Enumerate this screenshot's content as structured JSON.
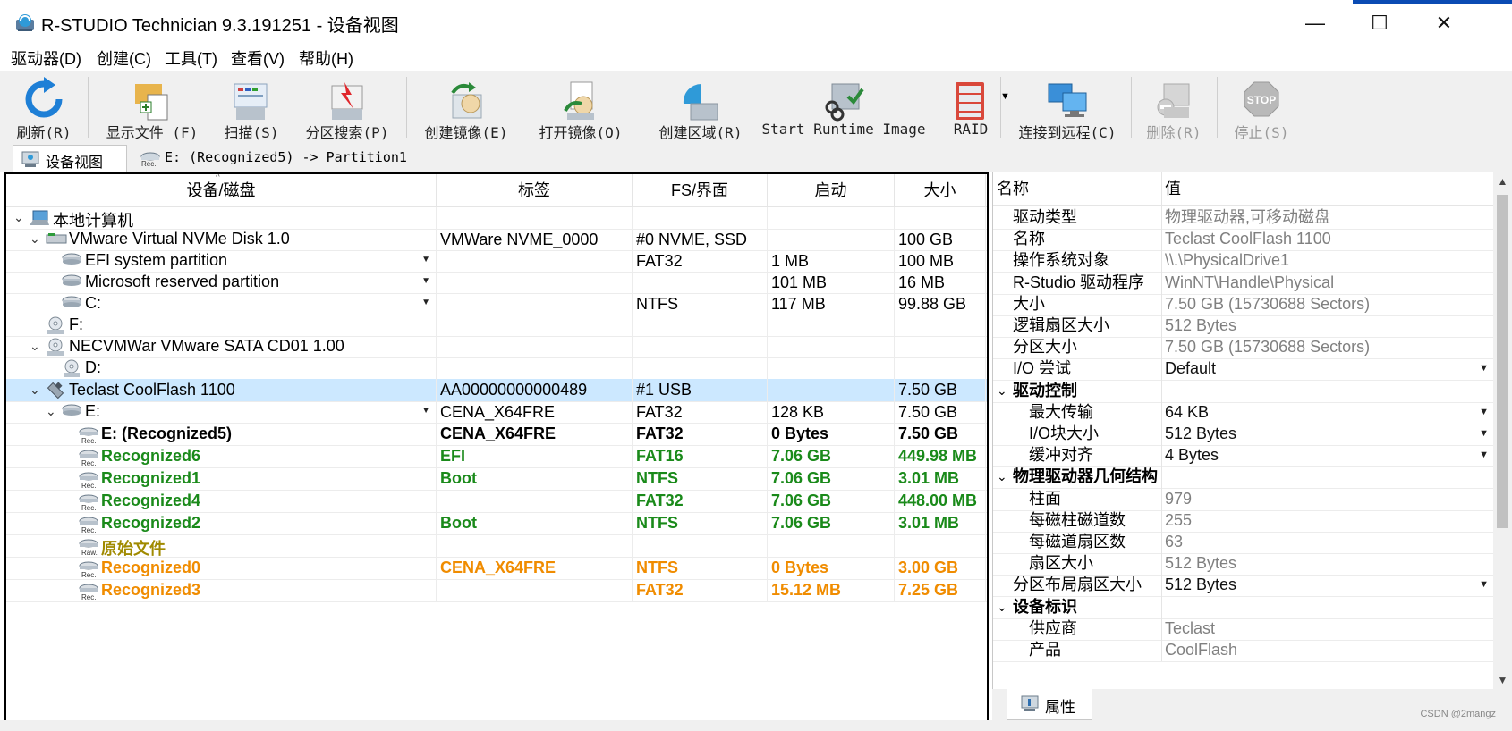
{
  "window": {
    "title": "R-STUDIO Technician 9.3.191251 - 设备视图",
    "minimize": "—",
    "maximize": "☐",
    "close": "✕"
  },
  "menu": [
    "驱动器(D)",
    "创建(C)",
    "工具(T)",
    "查看(V)",
    "帮助(H)"
  ],
  "toolbar": [
    {
      "label": "刷新(R)",
      "icon": "refresh-icon",
      "disabled": false
    },
    {
      "label": "显示文件 (F)",
      "icon": "show-files-icon",
      "disabled": false
    },
    {
      "label": "扫描(S)",
      "icon": "scan-icon",
      "disabled": false
    },
    {
      "label": "分区搜索(P)",
      "icon": "partition-search-icon",
      "disabled": false
    },
    {
      "label": "创建镜像(E)",
      "icon": "create-image-icon",
      "disabled": false
    },
    {
      "label": "打开镜像(O)",
      "icon": "open-image-icon",
      "disabled": false
    },
    {
      "label": "创建区域(R)",
      "icon": "create-region-icon",
      "disabled": false
    },
    {
      "label": "Start Runtime Image",
      "icon": "runtime-image-icon",
      "disabled": false
    },
    {
      "label": "RAID",
      "icon": "raid-icon",
      "disabled": false
    },
    {
      "label": "连接到远程(C)",
      "icon": "connect-remote-icon",
      "disabled": false
    },
    {
      "label": "删除(R)",
      "icon": "delete-icon",
      "disabled": true
    },
    {
      "label": "停止(S)",
      "icon": "stop-icon",
      "disabled": true
    }
  ],
  "tabs": [
    {
      "label": "设备视图",
      "active": true
    },
    {
      "label": "E: (Recognized5) -> Partition1",
      "active": false
    }
  ],
  "device_table": {
    "columns": [
      "设备/磁盘",
      "标签",
      "FS/界面",
      "启动",
      "大小"
    ],
    "rows": [
      {
        "name": "本地计算机",
        "label": "",
        "fs": "",
        "start": "",
        "size": "",
        "style": ""
      },
      {
        "name": "VMware Virtual NVMe Disk 1.0",
        "label": "VMWare NVME_0000",
        "fs": "#0 NVME, SSD",
        "start": "",
        "size": "100 GB",
        "style": ""
      },
      {
        "name": "EFI system partition",
        "label": "",
        "fs": "FAT32",
        "start": "1 MB",
        "size": "100 MB",
        "style": ""
      },
      {
        "name": "Microsoft reserved partition",
        "label": "",
        "fs": "",
        "start": "101 MB",
        "size": "16 MB",
        "style": ""
      },
      {
        "name": "C:",
        "label": "",
        "fs": "NTFS",
        "start": "117 MB",
        "size": "99.88 GB",
        "style": ""
      },
      {
        "name": "F:",
        "label": "",
        "fs": "",
        "start": "",
        "size": "",
        "style": ""
      },
      {
        "name": "NECVMWar VMware SATA CD01 1.00",
        "label": "",
        "fs": "",
        "start": "",
        "size": "",
        "style": ""
      },
      {
        "name": "D:",
        "label": "",
        "fs": "",
        "start": "",
        "size": "",
        "style": ""
      },
      {
        "name": "Teclast CoolFlash 1100",
        "label": "AA00000000000489",
        "fs": "#1 USB",
        "start": "",
        "size": "7.50 GB",
        "style": "selected"
      },
      {
        "name": "E:",
        "label": "CENA_X64FRE",
        "fs": "FAT32",
        "start": "128 KB",
        "size": "7.50 GB",
        "style": ""
      },
      {
        "name": "E: (Recognized5)",
        "label": "CENA_X64FRE",
        "fs": "FAT32",
        "start": "0 Bytes",
        "size": "7.50 GB",
        "style": "bold"
      },
      {
        "name": "Recognized6",
        "label": "EFI",
        "fs": "FAT16",
        "start": "7.06 GB",
        "size": "449.98 MB",
        "style": "green"
      },
      {
        "name": "Recognized1",
        "label": "Boot",
        "fs": "NTFS",
        "start": "7.06 GB",
        "size": "3.01 MB",
        "style": "green"
      },
      {
        "name": "Recognized4",
        "label": "",
        "fs": "FAT32",
        "start": "7.06 GB",
        "size": "448.00 MB",
        "style": "green"
      },
      {
        "name": "Recognized2",
        "label": "Boot",
        "fs": "NTFS",
        "start": "7.06 GB",
        "size": "3.01 MB",
        "style": "green"
      },
      {
        "name": "原始文件",
        "label": "",
        "fs": "",
        "start": "",
        "size": "",
        "style": "olive"
      },
      {
        "name": "Recognized0",
        "label": "CENA_X64FRE",
        "fs": "NTFS",
        "start": "0 Bytes",
        "size": "3.00 GB",
        "style": "orange"
      },
      {
        "name": "Recognized3",
        "label": "",
        "fs": "FAT32",
        "start": "15.12 MB",
        "size": "7.25 GB",
        "style": "orange"
      }
    ]
  },
  "small_icon_text": {
    "rec": "Rec.",
    "raw": "Raw."
  },
  "properties": {
    "columns": [
      "名称",
      "值"
    ],
    "rows": [
      {
        "name": "驱动类型",
        "value": "物理驱动器,可移动磁盘",
        "kind": "ro",
        "indent": 1
      },
      {
        "name": "名称",
        "value": "Teclast CoolFlash 1100",
        "kind": "ro",
        "indent": 1
      },
      {
        "name": "操作系统对象",
        "value": "\\\\.\\PhysicalDrive1",
        "kind": "ro",
        "indent": 1
      },
      {
        "name": "R-Studio 驱动程序",
        "value": "WinNT\\Handle\\Physical",
        "kind": "ro",
        "indent": 1
      },
      {
        "name": "大小",
        "value": "7.50 GB (15730688 Sectors)",
        "kind": "ro",
        "indent": 1
      },
      {
        "name": "逻辑扇区大小",
        "value": "512 Bytes",
        "kind": "ro",
        "indent": 1
      },
      {
        "name": "分区大小",
        "value": "7.50 GB (15730688 Sectors)",
        "kind": "ro",
        "indent": 1
      },
      {
        "name": "I/O 尝试",
        "value": "Default",
        "kind": "dd",
        "indent": 1
      },
      {
        "name": "驱动控制",
        "value": "",
        "kind": "group",
        "indent": 0
      },
      {
        "name": "最大传输",
        "value": "64 KB",
        "kind": "dd",
        "indent": 2
      },
      {
        "name": "I/O块大小",
        "value": "512 Bytes",
        "kind": "dd",
        "indent": 2
      },
      {
        "name": "缓冲对齐",
        "value": "4 Bytes",
        "kind": "dd",
        "indent": 2
      },
      {
        "name": "物理驱动器几何结构",
        "value": "",
        "kind": "group",
        "indent": 0
      },
      {
        "name": "柱面",
        "value": "979",
        "kind": "ro",
        "indent": 2
      },
      {
        "name": "每磁柱磁道数",
        "value": "255",
        "kind": "ro",
        "indent": 2
      },
      {
        "name": "每磁道扇区数",
        "value": "63",
        "kind": "ro",
        "indent": 2
      },
      {
        "name": "扇区大小",
        "value": "512 Bytes",
        "kind": "ro",
        "indent": 2
      },
      {
        "name": "分区布局扇区大小",
        "value": "512 Bytes",
        "kind": "dd",
        "indent": 1
      },
      {
        "name": "设备标识",
        "value": "",
        "kind": "group",
        "indent": 0
      },
      {
        "name": "供应商",
        "value": "Teclast",
        "kind": "ro",
        "indent": 2
      },
      {
        "name": "产品",
        "value": "CoolFlash",
        "kind": "ro",
        "indent": 2
      }
    ]
  },
  "properties_tab": "属性",
  "watermark": "CSDN @2mangz",
  "colors": {
    "selected_row": "#cce8ff",
    "green": "#1a8a1a",
    "olive": "#a08a00",
    "orange": "#f08c00",
    "readonly_value": "#808080"
  }
}
